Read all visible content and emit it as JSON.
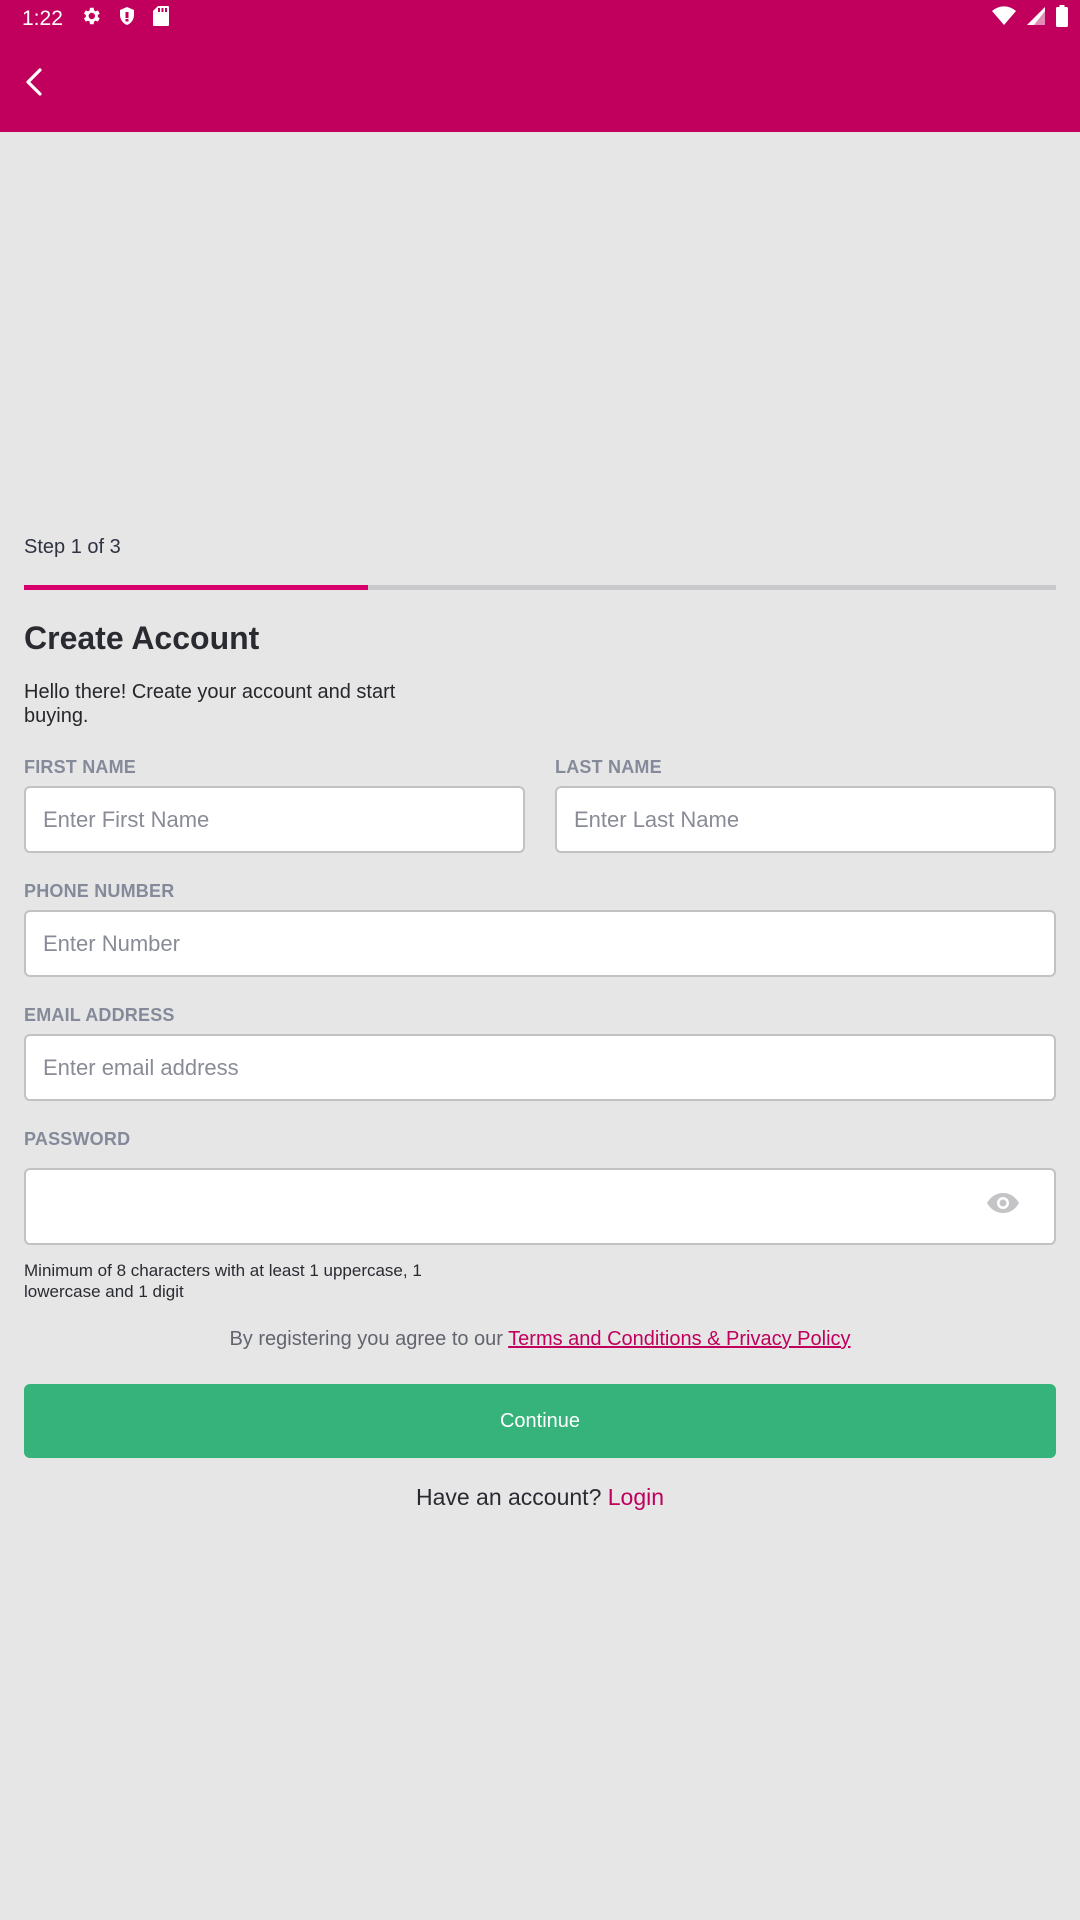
{
  "status_bar": {
    "time": "1:22",
    "icons": [
      "gear-icon",
      "shield-icon",
      "sd-card-icon",
      "wifi-icon",
      "signal-icon",
      "battery-icon"
    ]
  },
  "app_bar": {
    "back_icon": "back-arrow-icon"
  },
  "colors": {
    "brand": "#c0005c",
    "accent": "#d8006d",
    "continue": "#36b37a",
    "background": "#e6e6e7"
  },
  "progress": {
    "label": "Step 1 of 3",
    "current_step": 1,
    "total_steps": 3
  },
  "form": {
    "title": "Create Account",
    "subtitle": "Hello there! Create your account and start buying.",
    "first_name": {
      "label": "FIRST NAME",
      "placeholder": "Enter First Name",
      "value": ""
    },
    "last_name": {
      "label": "LAST NAME",
      "placeholder": "Enter Last Name",
      "value": ""
    },
    "phone": {
      "label": "PHONE NUMBER",
      "placeholder": "Enter Number",
      "value": ""
    },
    "email": {
      "label": "EMAIL ADDRESS",
      "placeholder": "Enter email address",
      "value": ""
    },
    "password": {
      "label": "PASSWORD",
      "placeholder": "",
      "value": "",
      "toggle_icon": "eye-icon"
    },
    "password_hint": "Minimum of 8 characters with at least 1 uppercase, 1 lowercase and 1 digit"
  },
  "terms": {
    "prefix": "By registering you agree to our ",
    "link": "Terms and Conditions & Privacy Policy"
  },
  "continue_label": "Continue",
  "footer": {
    "prompt": "Have an account? ",
    "login": "Login"
  }
}
